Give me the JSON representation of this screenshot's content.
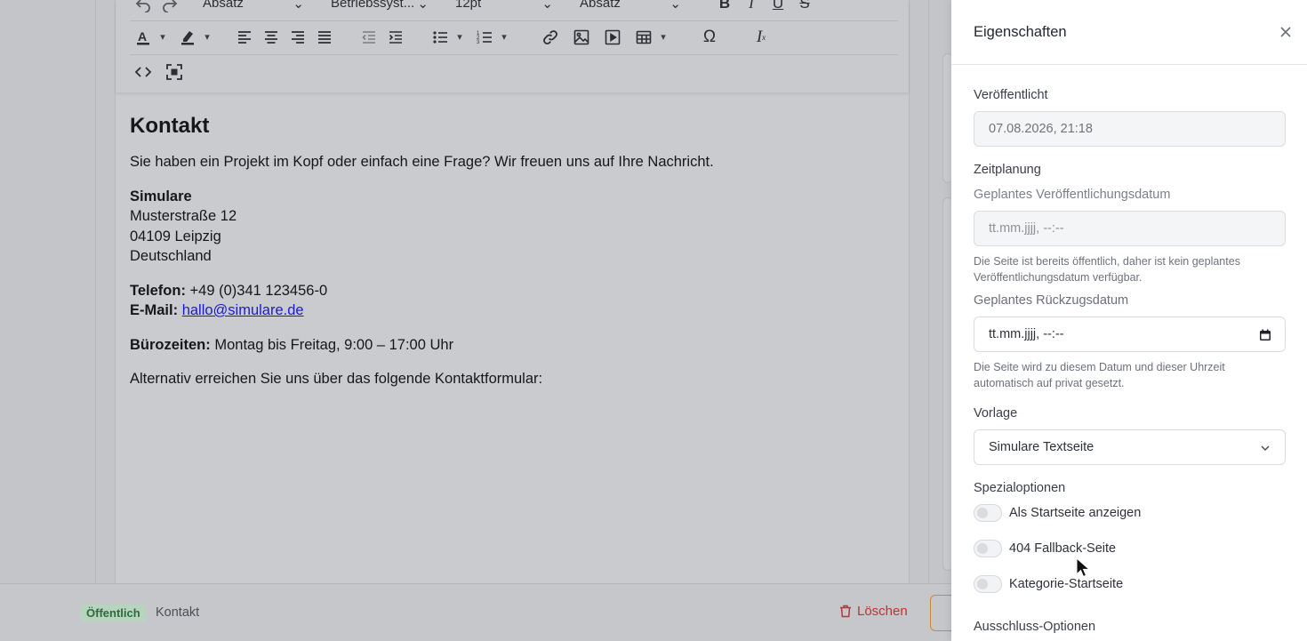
{
  "toolbar": {
    "row0": {
      "paragraph_select": "Absatz",
      "font_select": "Betriebssyst...",
      "size_select": "12pt",
      "format_select": "Absatz"
    }
  },
  "editor": {
    "heading": "Kontakt",
    "intro": "Sie haben ein Projekt im Kopf oder einfach eine Frage? Wir freuen uns auf Ihre Nachricht.",
    "company": "Simulare",
    "street": "Musterstraße 12",
    "city": "04109 Leipzig",
    "country": "Deutschland",
    "phone_label": "Telefon:",
    "phone_value": "+49 (0)341 123456-0",
    "email_label": "E-Mail:",
    "email_value": "hallo@simulare.de",
    "hours_label": "Bürozeiten:",
    "hours_value": "Montag bis Freitag, 9:00 – 17:00 Uhr",
    "form_hint": "Alternativ erreichen Sie uns über das folgende Kontaktformular:"
  },
  "bottombar": {
    "status_badge": "Öffentlich",
    "breadcrumb": "Kontakt",
    "delete_label": "Löschen"
  },
  "panel": {
    "title": "Eigenschaften",
    "published": {
      "label": "Veröffentlicht",
      "value": "07.08.2026, 21:18"
    },
    "scheduling": {
      "label": "Zeitplanung",
      "publish_date_label": "Geplantes Veröffentlichungsdatum",
      "publish_date_placeholder": "tt.mm.jjjj, --:--",
      "publish_help": "Die Seite ist bereits öffentlich, daher ist kein geplantes Veröffentlichungsdatum verfügbar.",
      "withdraw_date_label": "Geplantes Rückzugsdatum",
      "withdraw_date_placeholder": "tt.mm.jjjj, --:--",
      "withdraw_help": "Die Seite wird zu diesem Datum und dieser Uhrzeit automatisch auf privat gesetzt."
    },
    "template": {
      "label": "Vorlage",
      "value": "Simulare Textseite"
    },
    "special": {
      "label": "Spezialoptionen",
      "options": [
        {
          "label": "Als Startseite anzeigen",
          "checked": false
        },
        {
          "label": "404 Fallback-Seite",
          "checked": false
        },
        {
          "label": "Kategorie-Startseite",
          "checked": false
        }
      ]
    },
    "exclusion": {
      "label": "Ausschluss-Optionen"
    }
  },
  "colors": {
    "accent_green": "#2c6b3d",
    "delete_red": "#c0312f",
    "link_blue": "#1a1ad6"
  }
}
